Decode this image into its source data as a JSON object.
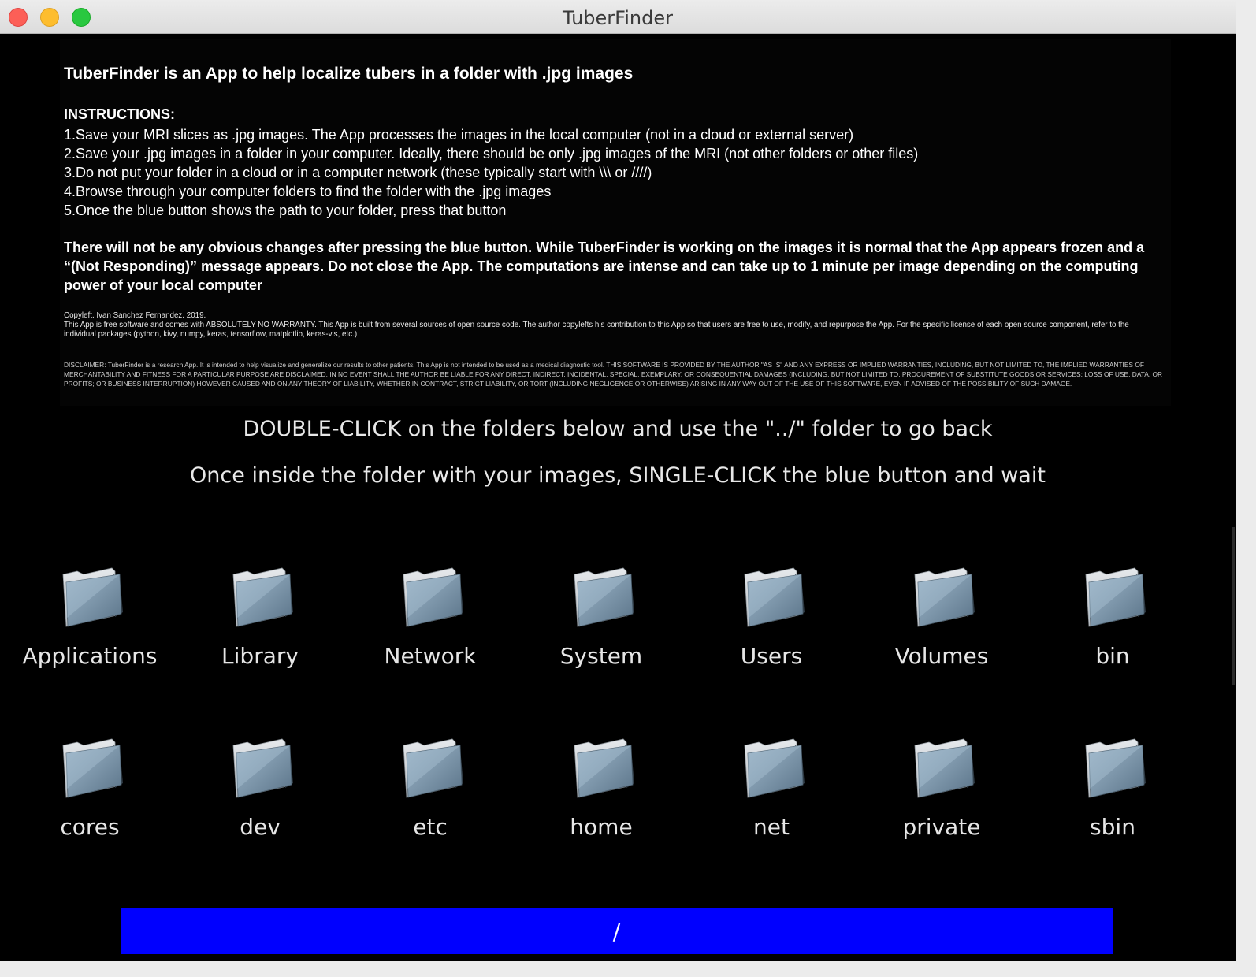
{
  "window": {
    "title": "TuberFinder"
  },
  "info": {
    "heading": "TuberFinder is an App to help localize tubers in a folder with .jpg images",
    "instructions_heading": "INSTRUCTIONS:",
    "instructions": [
      "1.Save your MRI slices as .jpg images. The App processes the images in the local computer (not in a cloud or external server)",
      "2.Save your .jpg images in a folder in your computer. Ideally, there should be only .jpg images of the MRI (not other folders or other files)",
      "3.Do not put your folder in a cloud or in a computer network (these typically start with \\\\\\ or ////)",
      "4.Browse through your computer folders to find the folder with the .jpg images",
      "5.Once the blue button shows the path to your folder, press that button"
    ],
    "warning": "There will not be any obvious changes after pressing the blue button. While TuberFinder is working on the images it is normal that the App appears frozen and a “(Not Responding)” message appears. Do not close the App. The computations are intense and can take up to 1 minute per image depending on the computing power of your local computer",
    "copyright_line": "Copyleft. Ivan Sanchez Fernandez. 2019.",
    "license": "This App is free software and comes with ABSOLUTELY NO WARRANTY. This App is built from several sources of open source code. The author copylefts his contribution to this App so that users are free to use, modify, and repurpose the App. For the specific license of each open source component, refer to the individual packages (python, kivy, numpy, keras, tensorflow, matplotlib, keras-vis, etc.)",
    "disclaimer": "DISCLAIMER: TuberFinder is a research App. It is intended to help visualize and generalize our results to other patients. This App is not intended to be used as a medical diagnostic tool. THIS SOFTWARE IS PROVIDED BY THE AUTHOR \"AS IS\" AND ANY EXPRESS OR IMPLIED WARRANTIES, INCLUDING, BUT NOT LIMITED TO, THE IMPLIED WARRANTIES OF MERCHANTABILITY AND FITNESS FOR A PARTICULAR PURPOSE ARE DISCLAIMED. IN NO EVENT SHALL THE AUTHOR BE LIABLE FOR ANY DIRECT, INDIRECT, INCIDENTAL, SPECIAL, EXEMPLARY, OR CONSEQUENTIAL DAMAGES (INCLUDING, BUT NOT LIMITED TO, PROCUREMENT OF SUBSTITUTE GOODS OR SERVICES; LOSS OF USE, DATA, OR PROFITS; OR BUSINESS INTERRUPTION) HOWEVER CAUSED AND ON ANY THEORY OF LIABILITY, WHETHER IN CONTRACT, STRICT LIABILITY, OR TORT (INCLUDING NEGLIGENCE OR OTHERWISE) ARISING IN ANY WAY OUT OF THE USE OF THIS SOFTWARE, EVEN IF ADVISED OF THE POSSIBILITY OF SUCH DAMAGE."
  },
  "hints": {
    "line1": "DOUBLE-CLICK on the folders below and use the \"../\" folder to go back",
    "line2": "Once inside the folder with your images, SINGLE-CLICK the blue button and wait"
  },
  "folders": [
    "Applications",
    "Library",
    "Network",
    "System",
    "Users",
    "Volumes",
    "bin",
    "cores",
    "dev",
    "etc",
    "home",
    "net",
    "private",
    "sbin"
  ],
  "folder_icon": "folder-icon",
  "path_button": {
    "label": "/",
    "color": "#0000ff"
  }
}
